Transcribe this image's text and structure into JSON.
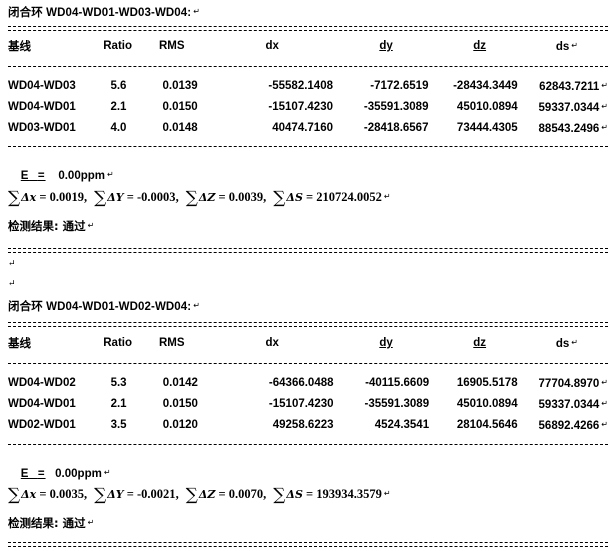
{
  "document": {
    "type": "gnss-closure-loop-report",
    "blocks": [
      {
        "title_label": "闭合环",
        "title_loop": "WD04-WD01-WD03-WD04:",
        "title_mark": "↵",
        "table": {
          "headers": [
            "基线",
            "Ratio",
            "RMS",
            "dx",
            "dy",
            "dz",
            "ds"
          ],
          "header_underlined": [
            "dy",
            "dz"
          ],
          "rows": [
            {
              "baseline": "WD04-WD03",
              "ratio": "5.6",
              "rms": "0.0139",
              "dx": "-55582.1408",
              "dy": "-7172.6519",
              "dz": "-28434.3449",
              "ds": "62843.7211"
            },
            {
              "baseline": "WD04-WD01",
              "ratio": "2.1",
              "rms": "0.0150",
              "dx": "-15107.4230",
              "dy": "-35591.3089",
              "dz": "45010.0894",
              "ds": "59337.0344"
            },
            {
              "baseline": "WD03-WD01",
              "ratio": "4.0",
              "rms": "0.0148",
              "dx": "40474.7160",
              "dy": "-28418.6567",
              "dz": "73444.4305",
              "ds": "88543.2496"
            }
          ]
        },
        "error_label": "E",
        "error_eq": "=",
        "error_value": "0.00ppm",
        "sums": {
          "dx_label": "Δx",
          "dx_value": "0.0019",
          "dy_label": "ΔY",
          "dy_value": "-0.0003",
          "dz_label": "ΔZ",
          "dz_value": "0.0039",
          "ds_label": "ΔS",
          "ds_value": "210724.0052"
        },
        "result_label": "检测结果:",
        "result_value": "通过"
      },
      {
        "title_label": "闭合环",
        "title_loop": "WD04-WD01-WD02-WD04:",
        "title_mark": "↵",
        "table": {
          "headers": [
            "基线",
            "Ratio",
            "RMS",
            "dx",
            "dy",
            "dz",
            "ds"
          ],
          "header_underlined": [
            "dy",
            "dz"
          ],
          "rows": [
            {
              "baseline": "WD04-WD02",
              "ratio": "5.3",
              "rms": "0.0142",
              "dx": "-64366.0488",
              "dy": "-40115.6609",
              "dz": "16905.5178",
              "ds": "77704.8970"
            },
            {
              "baseline": "WD04-WD01",
              "ratio": "2.1",
              "rms": "0.0150",
              "dx": "-15107.4230",
              "dy": "-35591.3089",
              "dz": "45010.0894",
              "ds": "59337.0344"
            },
            {
              "baseline": "WD02-WD01",
              "ratio": "3.5",
              "rms": "0.0120",
              "dx": "49258.6223",
              "dy": "4524.3541",
              "dz": "28104.5646",
              "ds": "56892.4266"
            }
          ]
        },
        "error_label": "E",
        "error_eq": "=",
        "error_value": "0.00ppm",
        "sums": {
          "dx_label": "Δx",
          "dx_value": "0.0035",
          "dy_label": "ΔY",
          "dy_value": "-0.0021",
          "dz_label": "ΔZ",
          "dz_value": "0.0070",
          "ds_label": "ΔS",
          "ds_value": "193934.3579"
        },
        "result_label": "检测结果:",
        "result_value": "通过"
      }
    ],
    "symbols": {
      "sigma": "∑",
      "equals": "=",
      "comma": ",",
      "paragraph_mark": "↵",
      "colon": ":"
    }
  }
}
